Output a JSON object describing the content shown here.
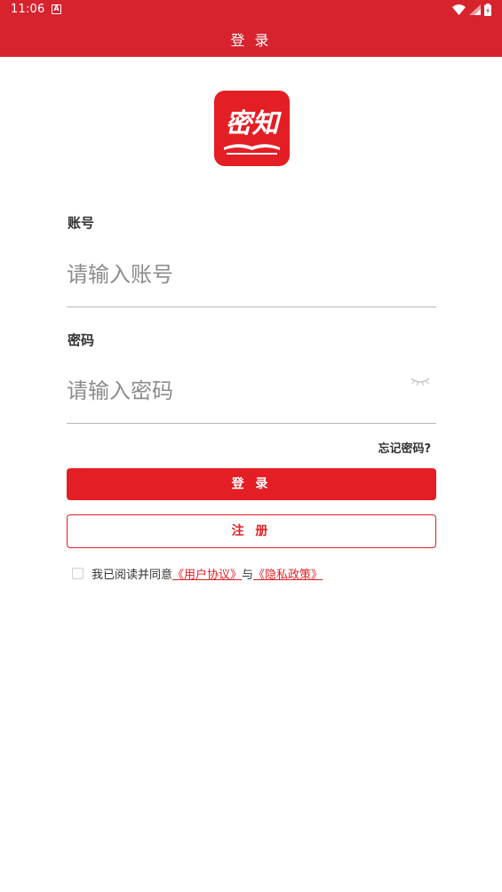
{
  "status_bar": {
    "time": "11:06",
    "notification_glyph": "A"
  },
  "header": {
    "title": "登 录"
  },
  "logo": {
    "text": "密知",
    "color": "#e31e24"
  },
  "account": {
    "label": "账号",
    "placeholder": "请输入账号"
  },
  "password": {
    "label": "密码",
    "placeholder": "请输入密码"
  },
  "forgot_password": "忘记密码?",
  "buttons": {
    "login": "登 录",
    "register": "注 册"
  },
  "agreement": {
    "prefix": "我已阅读并同意",
    "user_agreement": "《用户协议》",
    "conjunction": "与",
    "privacy_policy": "《隐私政策》"
  },
  "colors": {
    "header_bg": "#d7232e",
    "accent": "#e31e24"
  }
}
